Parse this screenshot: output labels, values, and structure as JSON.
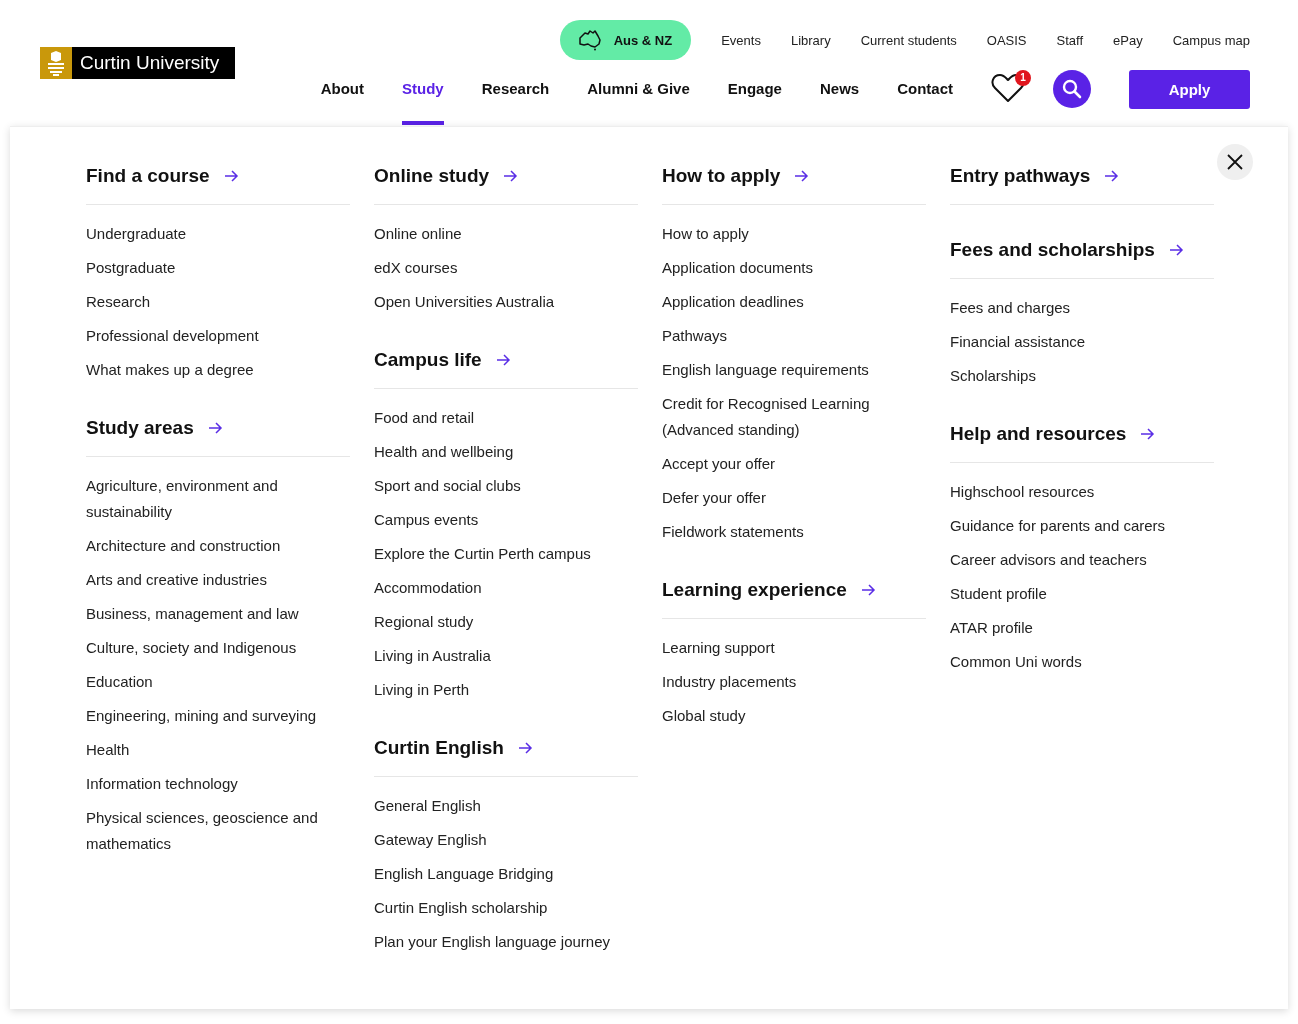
{
  "logo": {
    "text": "Curtin University"
  },
  "region": {
    "label": "Aus & NZ"
  },
  "utility_links": [
    "Events",
    "Library",
    "Current students",
    "OASIS",
    "Staff",
    "ePay",
    "Campus map"
  ],
  "nav": [
    {
      "label": "About",
      "selected": false
    },
    {
      "label": "Study",
      "selected": true
    },
    {
      "label": "Research",
      "selected": false
    },
    {
      "label": "Alumni & Give",
      "selected": false
    },
    {
      "label": "Engage",
      "selected": false
    },
    {
      "label": "News",
      "selected": false
    },
    {
      "label": "Contact",
      "selected": false
    }
  ],
  "wishlist": {
    "count": "1"
  },
  "apply_button": "Apply",
  "menu_columns": [
    {
      "sections": [
        {
          "title": "Find a course",
          "items": [
            "Undergraduate",
            "Postgraduate",
            "Research",
            "Professional development",
            "What makes up a degree"
          ]
        },
        {
          "title": "Study areas",
          "items": [
            "Agriculture, environment and sustainability",
            "Architecture and construction",
            "Arts and creative industries",
            "Business, management and law",
            "Culture, society and Indigenous",
            "Education",
            "Engineering, mining and surveying",
            "Health",
            "Information technology",
            "Physical sciences, geoscience and mathematics"
          ]
        }
      ]
    },
    {
      "sections": [
        {
          "title": "Online study",
          "items": [
            "Online online",
            "edX courses",
            "Open Universities Australia"
          ]
        },
        {
          "title": "Campus life",
          "items": [
            "Food and retail",
            "Health and wellbeing",
            "Sport and social clubs",
            "Campus events",
            "Explore the Curtin Perth campus",
            "Accommodation",
            "Regional study",
            "Living in Australia",
            "Living in Perth"
          ]
        },
        {
          "title": "Curtin English",
          "items": [
            "General English",
            "Gateway English",
            "English Language Bridging",
            "Curtin English scholarship",
            "Plan your English language journey"
          ]
        }
      ]
    },
    {
      "sections": [
        {
          "title": "How to apply",
          "items": [
            "How to apply",
            "Application documents",
            "Application deadlines",
            "Pathways",
            "English language requirements",
            "Credit for Recognised Learning (Advanced standing)",
            "Accept your offer",
            "Defer your offer",
            "Fieldwork statements"
          ]
        },
        {
          "title": "Learning experience",
          "items": [
            "Learning support",
            "Industry placements",
            "Global study"
          ]
        }
      ]
    },
    {
      "sections": [
        {
          "title": "Entry pathways"
        },
        {
          "title": "Fees and scholarships",
          "items": [
            "Fees and charges",
            "Financial assistance",
            "Scholarships"
          ]
        },
        {
          "title": "Help and resources",
          "items": [
            "Highschool resources",
            "Guidance for parents and carers",
            "Career advisors and teachers",
            "Student profile",
            "ATAR profile",
            "Common Uni words"
          ]
        }
      ]
    }
  ]
}
